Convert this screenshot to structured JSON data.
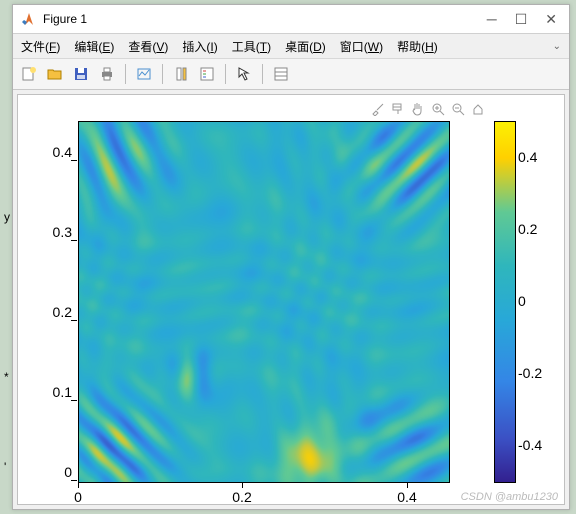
{
  "window": {
    "title": "Figure 1"
  },
  "menu": {
    "file": "文件(",
    "file_u": "F",
    "file_r": ")",
    "edit": "编辑(",
    "edit_u": "E",
    "edit_r": ")",
    "view": "查看(",
    "view_u": "V",
    "view_r": ")",
    "insert": "插入(",
    "insert_u": "I",
    "insert_r": ")",
    "tools": "工具(",
    "tools_u": "T",
    "tools_r": ")",
    "desktop": "桌面(",
    "desktop_u": "D",
    "desktop_r": ")",
    "window_l": "窗口(",
    "window_u": "W",
    "window_r": ")",
    "help": "帮助(",
    "help_u": "H",
    "help_r": ")"
  },
  "chart_data": {
    "type": "heatmap",
    "title": "",
    "xlabel": "",
    "ylabel": "",
    "xlim": [
      0,
      0.45
    ],
    "ylim": [
      0,
      0.45
    ],
    "x_ticks": [
      0,
      0.2,
      0.4
    ],
    "y_ticks": [
      0,
      0.1,
      0.2,
      0.3,
      0.4
    ],
    "colorbar": {
      "min": -0.5,
      "max": 0.5,
      "ticks": [
        -0.4,
        -0.2,
        0,
        0.2,
        0.4
      ],
      "colormap": "parula"
    },
    "description": "2D scalar field (e.g. vorticity from CFD simulation) on a 0.45×0.45 domain. Background near 0 (teal) with turbulent filamentary structures; positive swirls (yellow, up to ~0.5) concentrated in lower-left and upper-right corners; negative swirls (blue/purple, down to ~-0.5) in upper-left and lower-right corners. Central region roughly smooth near-zero."
  },
  "colorbar_labels": {
    "p4": "0.4",
    "p2": "0.2",
    "z": "0",
    "m2": "-0.2",
    "m4": "-0.4"
  },
  "yticks": {
    "t0": "0",
    "t1": "0.1",
    "t2": "0.2",
    "t3": "0.3",
    "t4": "0.4"
  },
  "xticks": {
    "t0": "0",
    "t2": "0.2",
    "t4": "0.4"
  },
  "watermark": "CSDN @ambu1230",
  "bg": {
    "star": "*"
  }
}
